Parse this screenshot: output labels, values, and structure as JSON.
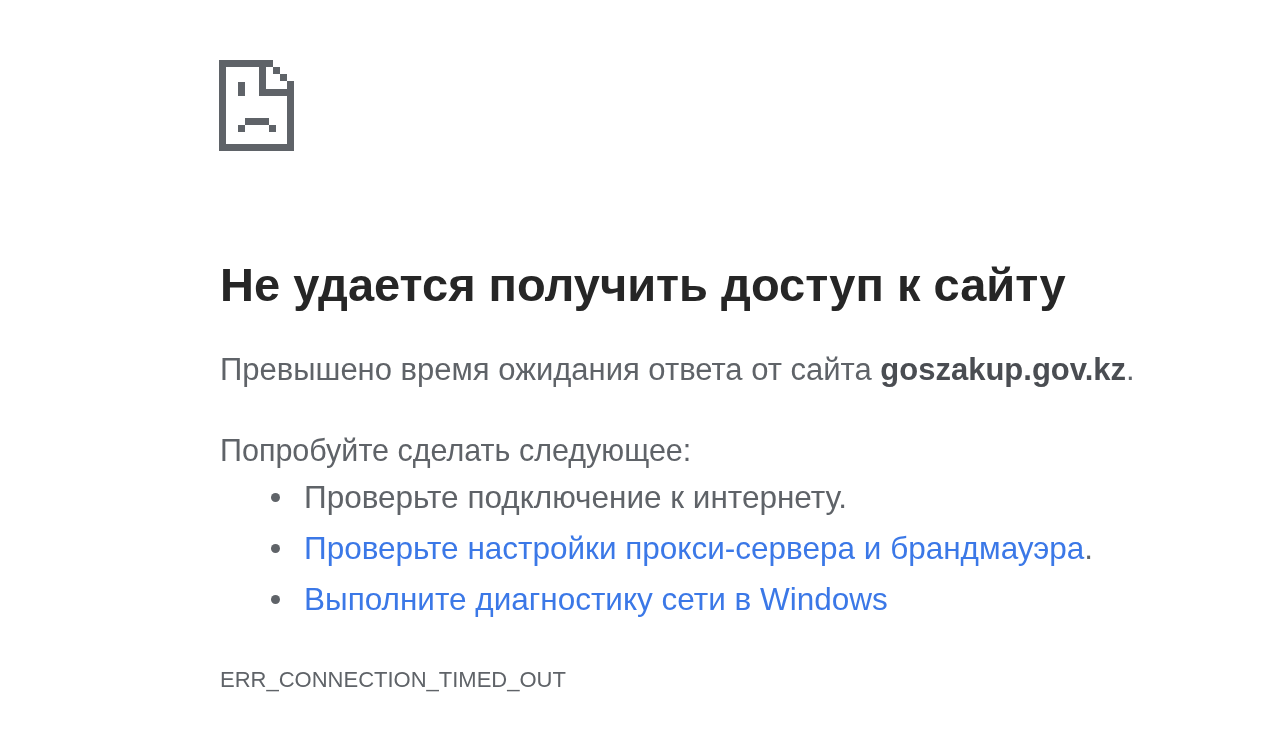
{
  "heading": "Не удается получить доступ к сайту",
  "message": "Превышено время ожидания ответа от сайта **goszakup.gov.kz**.",
  "suggestions_title": "Попробуйте сделать следующее:",
  "suggestions": [
    {
      "kind": "text",
      "text": "Проверьте подключение к интернету."
    },
    {
      "kind": "link",
      "link": "Проверьте настройки прокси-сервера и брандмауэра",
      "after": "."
    },
    {
      "kind": "link",
      "link": "Выполните диагностику сети в Windows"
    }
  ],
  "error_code": "ERR_CONNECTION_TIMED_OUT"
}
